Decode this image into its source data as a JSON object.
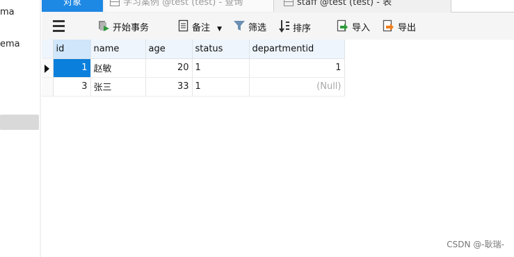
{
  "sidebar": {
    "items": [
      {
        "label": "ma"
      },
      {
        "label": "ema"
      }
    ]
  },
  "tabs": [
    {
      "label": "对象",
      "active": true
    },
    {
      "label": "学习案例 @test (test) - 查询"
    },
    {
      "label": "staff @test (test) - 表"
    }
  ],
  "toolbar": {
    "begin_transaction": "开始事务",
    "memo": "备注",
    "filter": "筛选",
    "sort": "排序",
    "import": "导入",
    "export": "导出"
  },
  "table": {
    "columns": [
      "id",
      "name",
      "age",
      "status",
      "departmentid"
    ],
    "rows": [
      {
        "id": "1",
        "name": "赵敏",
        "age": "20",
        "status": "1",
        "departmentid": "1"
      },
      {
        "id": "3",
        "name": "张三",
        "age": "33",
        "status": "1",
        "departmentid": "(Null)"
      }
    ]
  },
  "watermark": "CSDN @-耿瑞-",
  "colors": {
    "accent": "#1e88e5",
    "selected_cell": "#0a7fdc",
    "header_bg": "#eef5fc",
    "null_text": "#a8a8a8"
  },
  "icons": {
    "menu": "hamburger-icon",
    "begin_transaction": "transaction-icon",
    "memo": "memo-icon",
    "filter": "filter-icon",
    "sort": "sort-icon",
    "import": "import-icon",
    "export": "export-icon"
  }
}
